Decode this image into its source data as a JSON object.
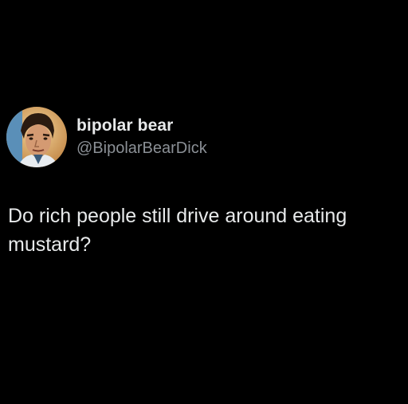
{
  "tweet": {
    "author": {
      "display_name": "bipolar bear",
      "handle": "@BipolarBearDick",
      "avatar_icon": "profile-photo"
    },
    "text": "Do rich people still drive around eating mustard?"
  },
  "colors": {
    "background": "#000000",
    "primary_text": "#e7e9ea",
    "secondary_text": "#8b9096"
  }
}
